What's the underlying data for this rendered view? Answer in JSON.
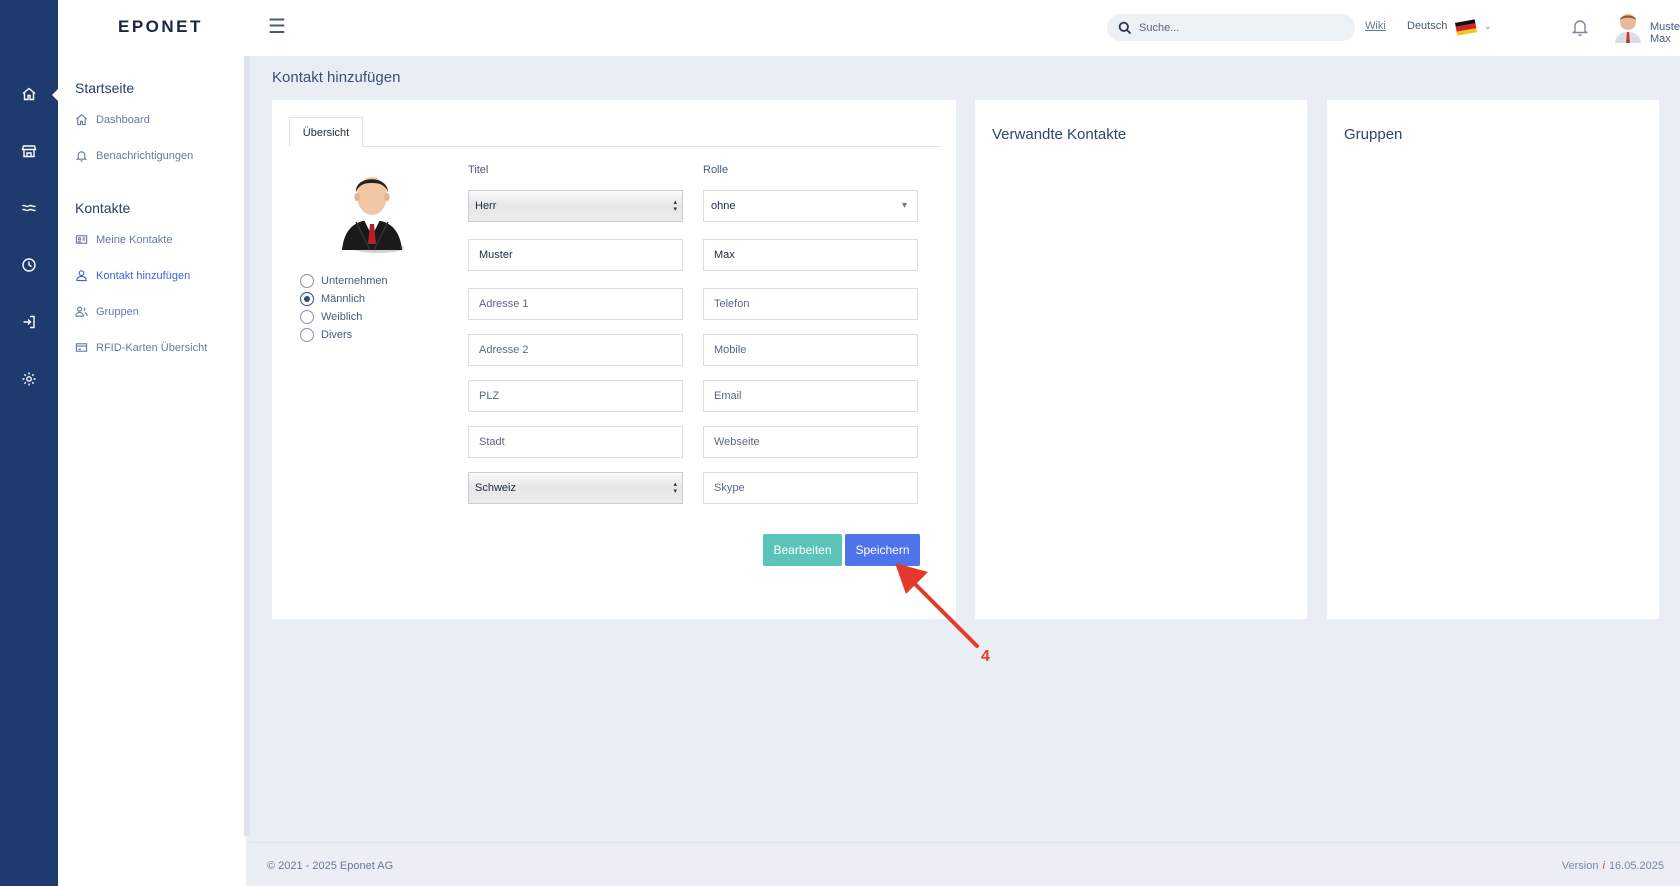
{
  "header": {
    "logo": "EPONET",
    "search_placeholder": "Suche...",
    "wiki": "Wiki",
    "language": "Deutsch",
    "user_name": "Muster Max"
  },
  "sidebar": {
    "sections": [
      {
        "title": "Startseite",
        "items": [
          {
            "label": "Dashboard",
            "icon": "home-icon"
          },
          {
            "label": "Benachrichtigungen",
            "icon": "bell-icon"
          }
        ]
      },
      {
        "title": "Kontakte",
        "items": [
          {
            "label": "Meine Kontakte",
            "icon": "contact-card-icon"
          },
          {
            "label": "Kontakt hinzufügen",
            "icon": "user-icon",
            "active": true
          },
          {
            "label": "Gruppen",
            "icon": "users-icon"
          },
          {
            "label": "RFID-Karten Übersicht",
            "icon": "credit-card-icon"
          }
        ]
      }
    ]
  },
  "rail_icons": [
    "home-icon",
    "store-icon",
    "waves-icon",
    "clock-icon",
    "login-icon",
    "settings-icon"
  ],
  "page": {
    "title": "Kontakt hinzufügen"
  },
  "form": {
    "tab": "Übersicht",
    "gender_options": [
      {
        "label": "Unternehmen",
        "checked": false
      },
      {
        "label": "Männlich",
        "checked": true
      },
      {
        "label": "Weiblich",
        "checked": false
      },
      {
        "label": "Divers",
        "checked": false
      }
    ],
    "titel_label": "Titel",
    "titel_value": "Herr",
    "rolle_label": "Rolle",
    "rolle_value": "ohne",
    "lastname_value": "Muster",
    "firstname_value": "Max",
    "address1_placeholder": "Adresse 1",
    "phone_placeholder": "Telefon",
    "address2_placeholder": "Adresse 2",
    "mobile_placeholder": "Mobile",
    "zip_placeholder": "PLZ",
    "email_placeholder": "Email",
    "city_placeholder": "Stadt",
    "website_placeholder": "Webseite",
    "country_value": "Schweiz",
    "skype_placeholder": "Skype",
    "edit_button": "Bearbeiten",
    "save_button": "Speichern"
  },
  "panels": {
    "related_title": "Verwandte Kontakte",
    "groups_title": "Gruppen"
  },
  "annotation": {
    "step": "4",
    "color": "#e53a2a"
  },
  "footer": {
    "copyright": "© 2021 - 2025 Eponet AG",
    "version_label": "Version",
    "version_info": "i",
    "version_date": "16.05.2025"
  },
  "colors": {
    "rail": "#1e3a6e",
    "primary": "#4f73ea",
    "teal": "#5bc4b8",
    "active_link": "#3d63d8"
  }
}
